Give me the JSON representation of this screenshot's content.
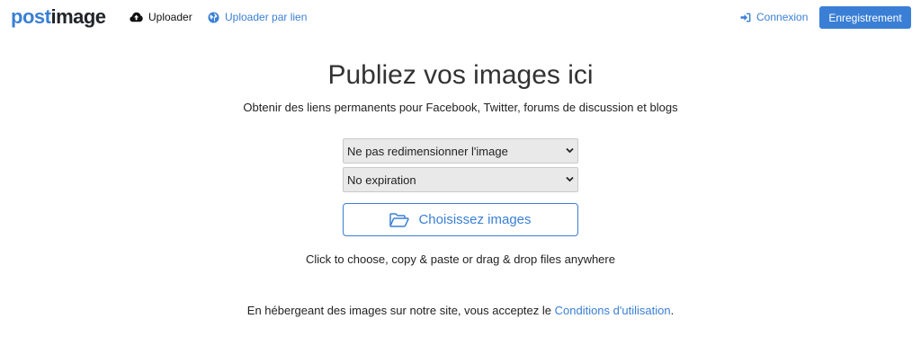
{
  "navbar": {
    "logo_part1": "post",
    "logo_part2": "image",
    "uploader_label": "Uploader",
    "uploader_url_label": "Uploader par lien",
    "login_label": "Connexion",
    "register_label": "Enregistrement",
    "icons": {
      "uploader": "cloud-upload-icon",
      "uploader_url": "globe-icon",
      "login": "sign-in-icon"
    }
  },
  "main": {
    "title": "Publiez vos images ici",
    "subtitle": "Obtenir des liens permanents pour Facebook, Twitter, forums de discussion et blogs",
    "resize_select": {
      "selected": "Ne pas redimensionner l'image"
    },
    "expiration_select": {
      "selected": "No expiration"
    },
    "choose_button_label": "Choisissez images",
    "choose_button_icon": "folder-open-icon",
    "hint": "Click to choose, copy & paste or drag & drop files anywhere",
    "terms_prefix": "En hébergeant des images sur notre site, vous acceptez le ",
    "terms_link": "Conditions d'utilisation",
    "terms_suffix": "."
  },
  "colors": {
    "accent": "#3a7fd5",
    "text": "#212529",
    "select_bg": "#e9e9e9"
  }
}
